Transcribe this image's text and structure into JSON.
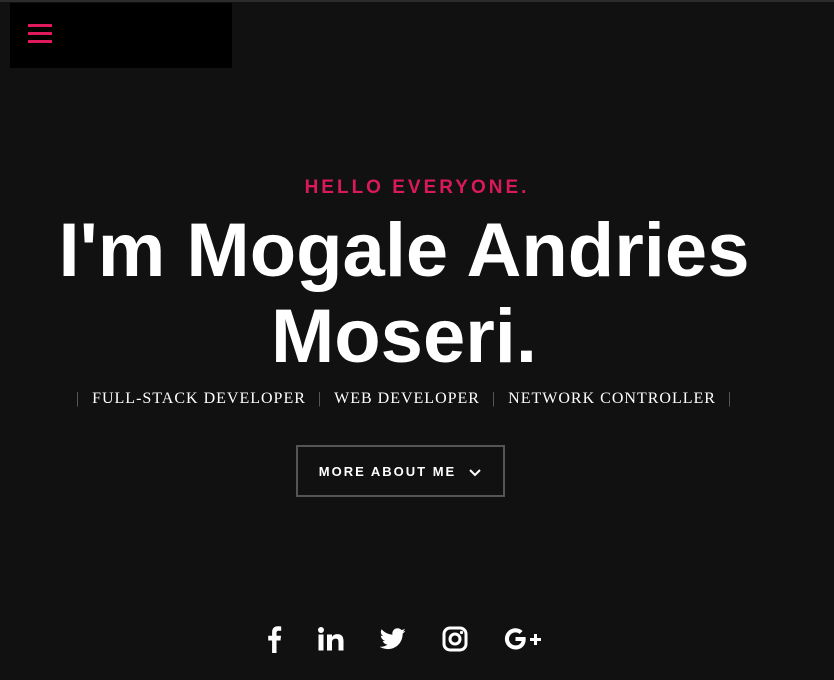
{
  "header": {
    "menu_icon": "hamburger-menu-icon"
  },
  "hero": {
    "greeting": "HELLO EVERYONE.",
    "headline_line1": "I'm Mogale Andries",
    "headline_line2": "Moseri.",
    "roles": [
      "FULL-STACK DEVELOPER",
      "WEB DEVELOPER",
      "NETWORK CONTROLLER"
    ],
    "separator": "|",
    "button_label": "MORE ABOUT ME",
    "button_icon": "chevron-down-icon"
  },
  "social": {
    "items": [
      {
        "name": "facebook-icon"
      },
      {
        "name": "linkedin-icon"
      },
      {
        "name": "twitter-icon"
      },
      {
        "name": "instagram-icon"
      },
      {
        "name": "google-plus-icon"
      }
    ]
  },
  "colors": {
    "background": "#111111",
    "accent": "#d9195b",
    "text": "#ffffff",
    "header_box": "#000000"
  }
}
